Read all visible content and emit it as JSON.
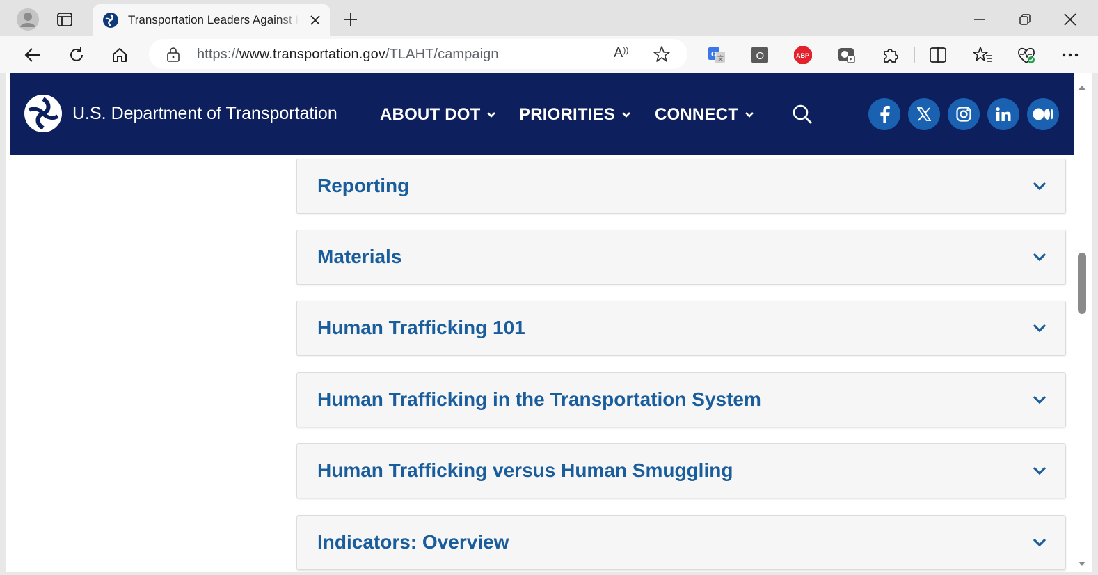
{
  "browser": {
    "tab_title": "Transportation Leaders Against Human Trafficking",
    "url_prefix": "https://",
    "url_host": "www.transportation.gov",
    "url_path": "/TLAHT/campaign",
    "read_aloud_glyph": "A",
    "extensions": [
      {
        "name": "google-translate-icon",
        "color": "#3b78e7"
      },
      {
        "name": "outline-extension-icon",
        "color": "#5a5a5a",
        "label": "O"
      },
      {
        "name": "adblock-plus-icon",
        "color": "#e4222e",
        "label": "ABP"
      },
      {
        "name": "screen-recorder-icon",
        "color": "#555555"
      }
    ]
  },
  "site": {
    "name": "U.S. Department of Transportation",
    "nav": [
      {
        "label": "ABOUT DOT"
      },
      {
        "label": "PRIORITIES"
      },
      {
        "label": "CONNECT"
      }
    ],
    "social": [
      {
        "name": "facebook-icon",
        "glyph": "f"
      },
      {
        "name": "x-twitter-icon",
        "glyph": "𝕏"
      },
      {
        "name": "instagram-icon",
        "glyph": ""
      },
      {
        "name": "linkedin-icon",
        "glyph": "in"
      },
      {
        "name": "medium-icon",
        "glyph": ""
      }
    ],
    "colors": {
      "header_bg": "#0d1f5c",
      "social_bg": "#1a61b2",
      "accordion_title": "#1a5d9c"
    }
  },
  "accordions": [
    {
      "title": "Reporting"
    },
    {
      "title": "Materials"
    },
    {
      "title": "Human Trafficking 101"
    },
    {
      "title": "Human Trafficking in the Transportation System"
    },
    {
      "title": "Human Trafficking versus Human Smuggling"
    },
    {
      "title": "Indicators: Overview"
    }
  ]
}
